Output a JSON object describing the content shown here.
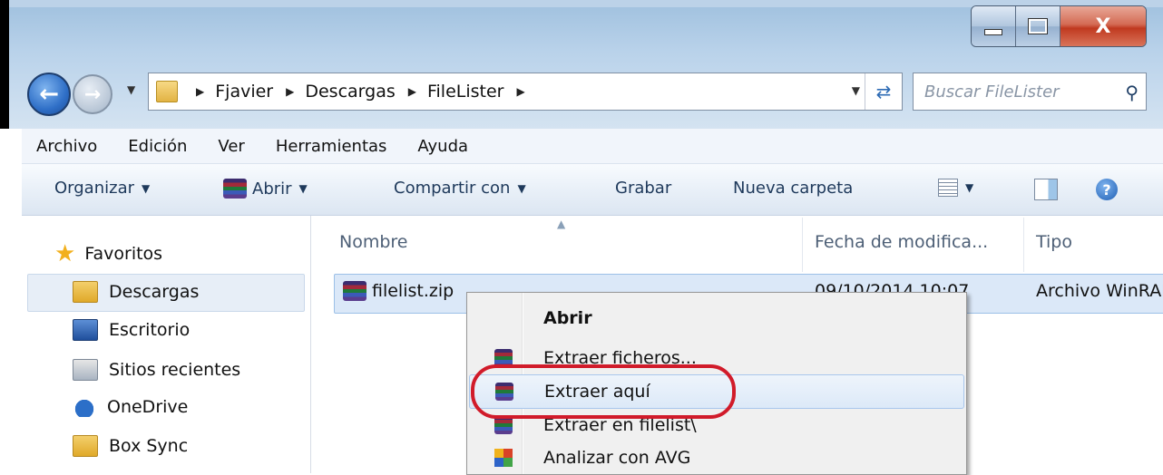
{
  "window": {
    "minimize_label": "—",
    "maximize_label": "□",
    "close_label": "X"
  },
  "address": {
    "crumbs": [
      "Fjavier",
      "Descargas",
      "FileLister"
    ],
    "search_placeholder": "Buscar FileLister"
  },
  "menu": [
    "Archivo",
    "Edición",
    "Ver",
    "Herramientas",
    "Ayuda"
  ],
  "toolbar": {
    "organize": "Organizar",
    "open": "Abrir",
    "share": "Compartir con",
    "burn": "Grabar",
    "new_folder": "Nueva carpeta"
  },
  "nav": {
    "favorites": "Favoritos",
    "items": [
      "Descargas",
      "Escritorio",
      "Sitios recientes",
      "OneDrive",
      "Box Sync"
    ]
  },
  "columns": {
    "name": "Nombre",
    "date": "Fecha de modifica...",
    "type": "Tipo"
  },
  "file": {
    "name": "filelist.zip",
    "date": "09/10/2014 10:07",
    "type": "Archivo WinRAR"
  },
  "context_menu": {
    "items": [
      "Abrir",
      "Extraer ficheros...",
      "Extraer aquí",
      "Extraer en filelist\\",
      "Analizar con AVG"
    ],
    "highlighted": "Extraer aquí"
  },
  "colors": {
    "highlight_ring": "#d11b2a",
    "selection": "#dbe8f8"
  }
}
